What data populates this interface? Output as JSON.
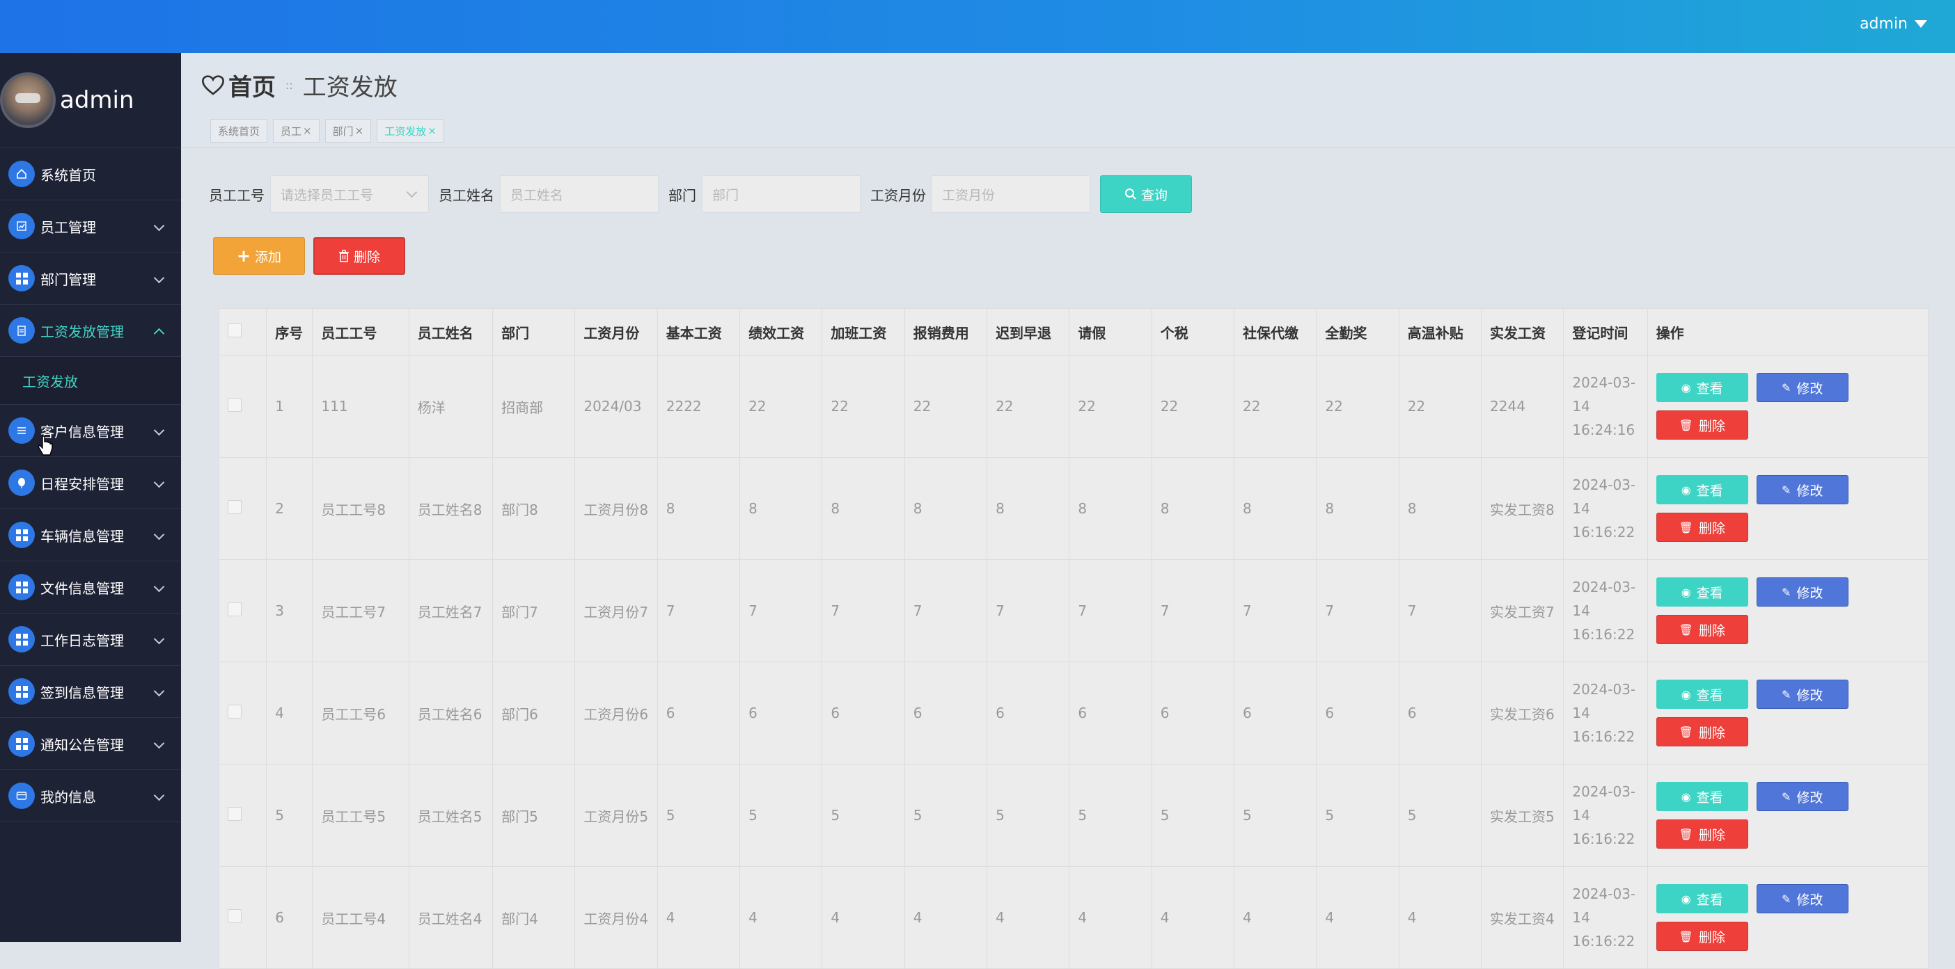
{
  "topbar": {
    "user": "admin"
  },
  "sidebar": {
    "profile_name": "admin",
    "items": [
      {
        "label": "系统首页",
        "icon": "home-icon"
      },
      {
        "label": "员工管理",
        "icon": "chart-icon"
      },
      {
        "label": "部门管理",
        "icon": "grid-icon"
      },
      {
        "label": "工资发放管理",
        "icon": "clipboard-icon",
        "expanded": true
      },
      {
        "label": "客户信息管理",
        "icon": "list-icon"
      },
      {
        "label": "日程安排管理",
        "icon": "balloon-icon"
      },
      {
        "label": "车辆信息管理",
        "icon": "grid-icon"
      },
      {
        "label": "文件信息管理",
        "icon": "grid-icon"
      },
      {
        "label": "工作日志管理",
        "icon": "grid-icon"
      },
      {
        "label": "签到信息管理",
        "icon": "grid-icon"
      },
      {
        "label": "通知公告管理",
        "icon": "grid-icon"
      },
      {
        "label": "我的信息",
        "icon": "card-icon"
      }
    ],
    "submenu": {
      "label": "工资发放"
    }
  },
  "header": {
    "home": "首页",
    "current": "工资发放",
    "tags": [
      {
        "label": "系统首页",
        "closable": false
      },
      {
        "label": "员工",
        "closable": true
      },
      {
        "label": "部门",
        "closable": true
      },
      {
        "label": "工资发放",
        "closable": true,
        "active": true
      }
    ]
  },
  "search": {
    "emp_no_label": "员工工号",
    "emp_no_placeholder": "请选择员工工号",
    "emp_name_label": "员工姓名",
    "emp_name_placeholder": "员工姓名",
    "dept_label": "部门",
    "dept_placeholder": "部门",
    "month_label": "工资月份",
    "month_placeholder": "工资月份",
    "query_label": "查询"
  },
  "actions": {
    "add_label": "添加",
    "delete_label": "删除"
  },
  "table": {
    "headers": [
      "序号",
      "员工工号",
      "员工姓名",
      "部门",
      "工资月份",
      "基本工资",
      "绩效工资",
      "加班工资",
      "报销费用",
      "迟到早退",
      "请假",
      "个税",
      "社保代缴",
      "全勤奖",
      "高温补贴",
      "实发工资",
      "登记时间",
      "操作"
    ],
    "rows": [
      [
        "1",
        "111",
        "杨洋",
        "招商部",
        "2024/03",
        "2222",
        "22",
        "22",
        "22",
        "22",
        "22",
        "22",
        "22",
        "22",
        "22",
        "2244",
        "2024-03-14 16:24:16"
      ],
      [
        "2",
        "员工工号8",
        "员工姓名8",
        "部门8",
        "工资月份8",
        "8",
        "8",
        "8",
        "8",
        "8",
        "8",
        "8",
        "8",
        "8",
        "8",
        "实发工资8",
        "2024-03-14 16:16:22"
      ],
      [
        "3",
        "员工工号7",
        "员工姓名7",
        "部门7",
        "工资月份7",
        "7",
        "7",
        "7",
        "7",
        "7",
        "7",
        "7",
        "7",
        "7",
        "7",
        "实发工资7",
        "2024-03-14 16:16:22"
      ],
      [
        "4",
        "员工工号6",
        "员工姓名6",
        "部门6",
        "工资月份6",
        "6",
        "6",
        "6",
        "6",
        "6",
        "6",
        "6",
        "6",
        "6",
        "6",
        "实发工资6",
        "2024-03-14 16:16:22"
      ],
      [
        "5",
        "员工工号5",
        "员工姓名5",
        "部门5",
        "工资月份5",
        "5",
        "5",
        "5",
        "5",
        "5",
        "5",
        "5",
        "5",
        "5",
        "5",
        "实发工资5",
        "2024-03-14 16:16:22"
      ],
      [
        "6",
        "员工工号4",
        "员工姓名4",
        "部门4",
        "工资月份4",
        "4",
        "4",
        "4",
        "4",
        "4",
        "4",
        "4",
        "4",
        "4",
        "4",
        "实发工资4",
        "2024-03-14 16:16:22"
      ]
    ],
    "ops": {
      "view": "查看",
      "edit": "修改",
      "delete": "删除"
    }
  },
  "colors": {
    "topbar": "#1e73e6",
    "sidebar": "#1e2235",
    "accent": "#3ed4c5",
    "edit": "#4f76d8",
    "danger": "#ee3f3a",
    "warning": "#f2a439"
  }
}
